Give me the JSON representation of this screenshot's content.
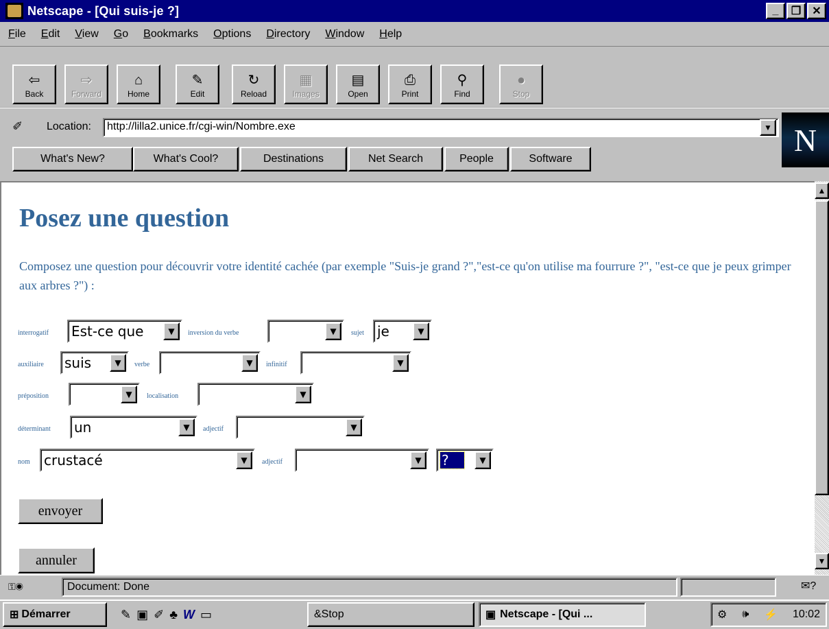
{
  "window": {
    "title": "Netscape - [Qui suis-je ?]",
    "controls": [
      "_",
      "❐",
      "✕"
    ]
  },
  "menu": [
    "File",
    "Edit",
    "View",
    "Go",
    "Bookmarks",
    "Options",
    "Directory",
    "Window",
    "Help"
  ],
  "toolbar": {
    "back": "Back",
    "forward": "Forward",
    "home": "Home",
    "edit": "Edit",
    "reload": "Reload",
    "images": "Images",
    "open": "Open",
    "print": "Print",
    "find": "Find",
    "stop": "Stop"
  },
  "location": {
    "label": "Location:",
    "url": "http://lilla2.unice.fr/cgi-win/Nombre.exe",
    "logo": "N"
  },
  "directory_buttons": [
    "What's New?",
    "What's Cool?",
    "Destinations",
    "Net Search",
    "People",
    "Software"
  ],
  "page": {
    "heading": "Posez une question",
    "intro": "Composez une question pour découvrir votre identité cachée (par exemple \"Suis-je grand ?\",\"est-ce qu'on utilise ma fourrure ?\", \"est-ce que je peux grimper aux arbres ?\") :",
    "form": {
      "interrogatif": {
        "label": "interrogatif",
        "value": "Est-ce que"
      },
      "inversion": {
        "label": "inversion du verbe",
        "value": ""
      },
      "sujet": {
        "label": "sujet",
        "value": "je"
      },
      "auxiliaire": {
        "label": "auxiliaire",
        "value": "suis"
      },
      "verbe": {
        "label": "verbe",
        "value": ""
      },
      "infinitif": {
        "label": "infinitif",
        "value": ""
      },
      "preposition": {
        "label": "préposition",
        "value": ""
      },
      "localisation": {
        "label": "localisation",
        "value": ""
      },
      "determinant": {
        "label": "déterminant",
        "value": "un"
      },
      "adjectif1": {
        "label": "adjectif",
        "value": ""
      },
      "nom": {
        "label": "nom",
        "value": "crustacé"
      },
      "adjectif2": {
        "label": "adjectif",
        "value": ""
      },
      "ponctuation": {
        "value": "?"
      }
    },
    "submit": "envoyer",
    "reset": "annuler"
  },
  "status": {
    "text": "Document: Done"
  },
  "taskbar": {
    "start": "Démarrer",
    "tasks": [
      "&Stop",
      "Netscape - [Qui ..."
    ],
    "clock": "10:02"
  },
  "colors": {
    "title_bg": "#000080",
    "heading": "#336699",
    "chrome": "#c0c0c0"
  }
}
